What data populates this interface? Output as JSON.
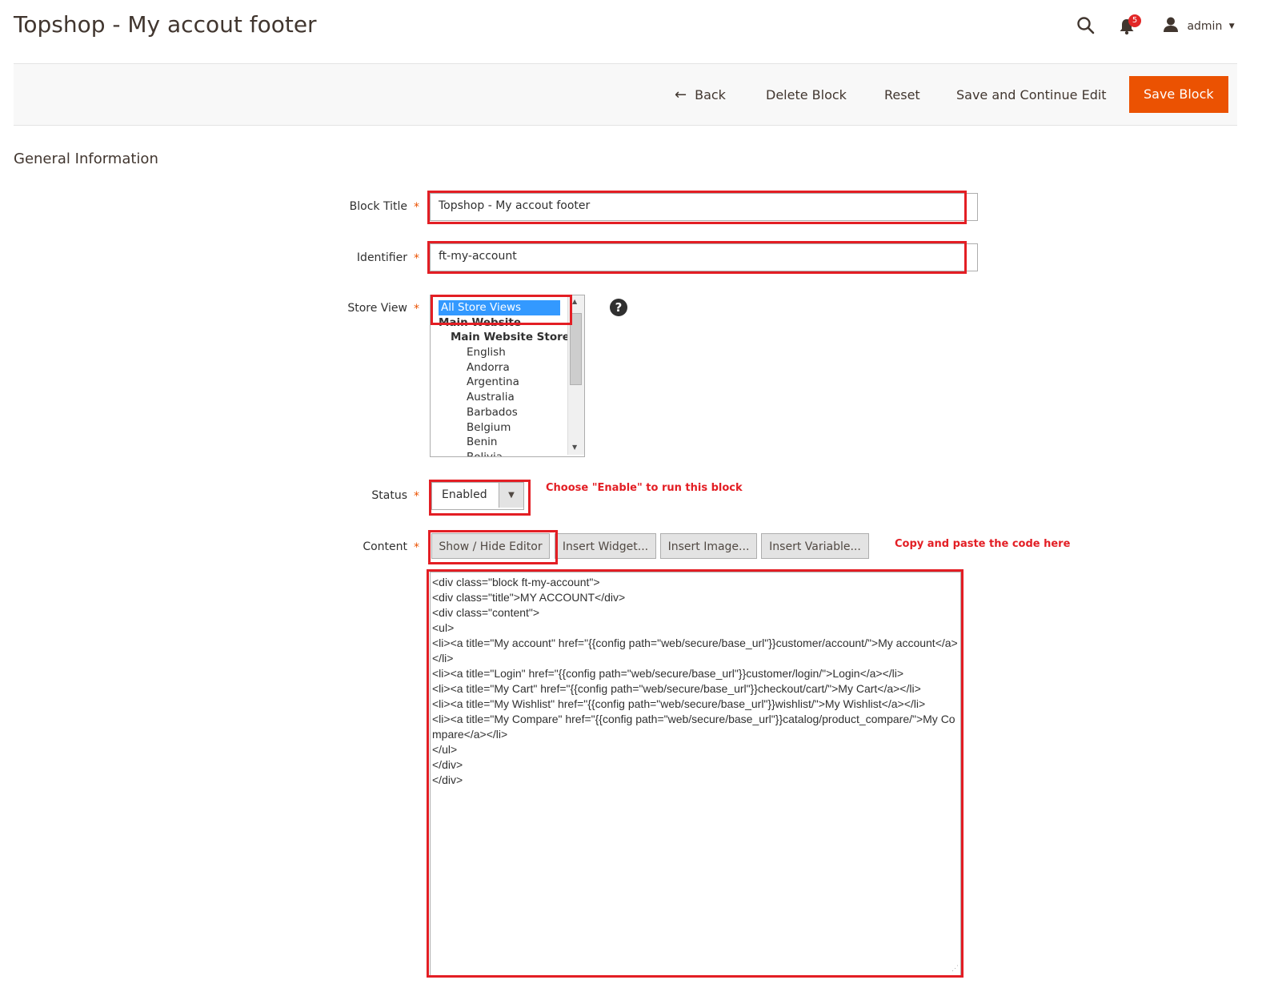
{
  "header": {
    "title": "Topshop - My accout footer",
    "notifications_count": "5",
    "user": "admin"
  },
  "toolbar": {
    "back": "Back",
    "delete": "Delete Block",
    "reset": "Reset",
    "save_continue": "Save and Continue Edit",
    "save": "Save Block"
  },
  "section": {
    "title": "General Information"
  },
  "form": {
    "block_title": {
      "label": "Block Title",
      "value": "Topshop - My accout footer"
    },
    "identifier": {
      "label": "Identifier",
      "value": "ft-my-account"
    },
    "store_view": {
      "label": "Store View",
      "selected": "All Store Views",
      "group": "Main Website",
      "subgroup": "Main Website Store",
      "options": [
        "English",
        "Andorra",
        "Argentina",
        "Australia",
        "Barbados",
        "Belgium",
        "Benin",
        "Bolivia"
      ]
    },
    "status": {
      "label": "Status",
      "value": "Enabled",
      "note": "Choose \"Enable\" to run this block"
    },
    "content": {
      "label": "Content",
      "buttons": [
        "Show / Hide Editor",
        "Insert Widget...",
        "Insert Image...",
        "Insert Variable..."
      ],
      "note": "Copy and paste the code here",
      "code": [
        "<div class=\"block ft-my-account\">",
        "<div class=\"title\">MY ACCOUNT</div>",
        "<div class=\"content\">",
        "<ul>",
        "<li><a title=\"My account\" href=\"{{config path=\"web/secure/base_url\"}}customer/account/\">My account</a></li>",
        "<li><a title=\"Login\" href=\"{{config path=\"web/secure/base_url\"}}customer/login/\">Login</a></li>",
        "<li><a title=\"My Cart\" href=\"{{config path=\"web/secure/base_url\"}}checkout/cart/\">My Cart</a></li>",
        "<li><a title=\"My Wishlist\" href=\"{{config path=\"web/secure/base_url\"}}wishlist/\">My Wishlist</a></li>",
        "<li><a title=\"My Compare\" href=\"{{config path=\"web/secure/base_url\"}}catalog/product_compare/\">My Compare</a></li>",
        "</ul>",
        "</div>",
        "</div>"
      ]
    },
    "required_mark": "*"
  },
  "colors": {
    "accent": "#eb5202",
    "highlight": "#e31e24",
    "selection": "#3399ff"
  }
}
